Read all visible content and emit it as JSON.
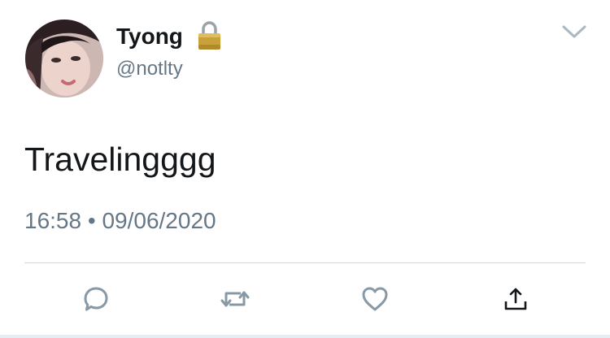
{
  "author": {
    "display_name": "Tyong",
    "handle": "@notlty",
    "protected": true
  },
  "tweet": {
    "text": "Travelingggg",
    "time": "16:58",
    "separator": "•",
    "date": "09/06/2020"
  },
  "actions": {
    "reply": "reply-icon",
    "retweet": "retweet-icon",
    "like": "heart-icon",
    "share": "share-icon"
  },
  "colors": {
    "text_primary": "#14171a",
    "text_secondary": "#657786",
    "icon_gray": "#8899a6",
    "divider": "#d6d9dc",
    "lock_gold": "#c9a13b"
  }
}
